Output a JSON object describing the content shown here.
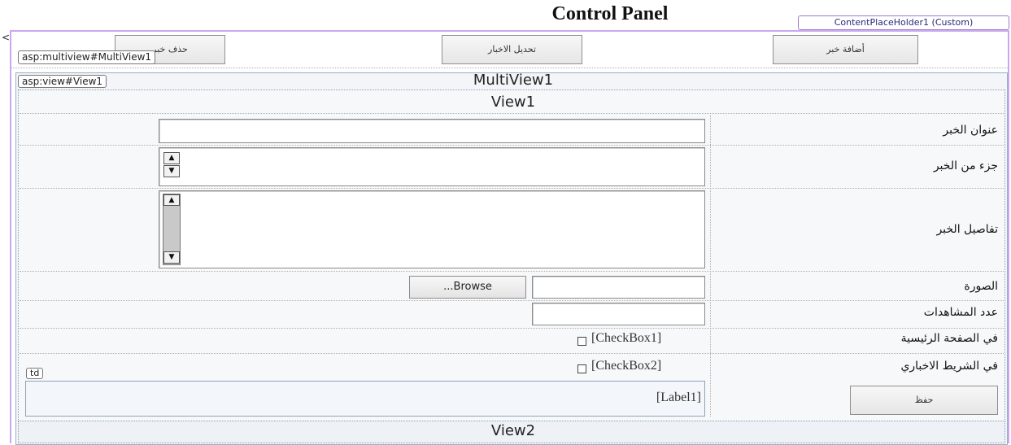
{
  "page": {
    "title": "Control Panel",
    "content_placeholder_tag": "ContentPlaceHolder1 (Custom)"
  },
  "toolbar": {
    "add_news": "أضافة خبر",
    "edit_news": "تحديل الاخبار",
    "delete_news": "حذف خبر"
  },
  "design_tags": {
    "multiview": "asp:multiview#MultiView1",
    "view": "asp:view#View1",
    "td": "td"
  },
  "multiview": {
    "title": "MultiView1",
    "view1_title": "View1",
    "view2_title": "View2"
  },
  "form": {
    "news_title_label": "عنوان الخبر",
    "news_excerpt_label": "جزء من الخبر",
    "news_details_label": "تفاصيل الخبر",
    "image_label": "الصورة",
    "views_count_label": "عدد المشاهدات",
    "home_page_label": "في الصفحة الرئيسية",
    "news_ticker_label": "في الشريط الاخباري",
    "browse_button": "...Browse",
    "checkbox1": "[CheckBox1]",
    "checkbox2": "[CheckBox2]",
    "label1": "[Label1]",
    "save_button": "حفظ"
  },
  "icons": {
    "scroll_up": "▲",
    "scroll_down": "▼",
    "collapse": "<"
  }
}
